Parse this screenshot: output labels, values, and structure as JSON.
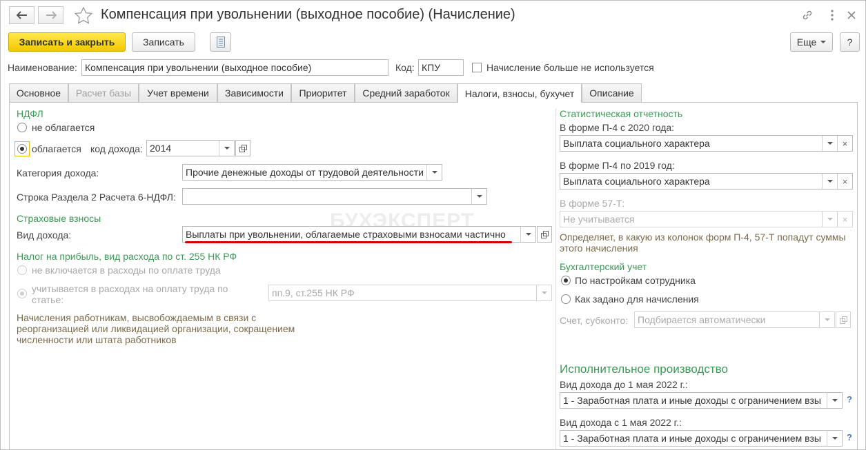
{
  "window": {
    "title": "Компенсация при увольнении (выходное пособие) (Начисление)"
  },
  "toolbar": {
    "save_close": "Записать и закрыть",
    "save": "Записать",
    "more": "Еще",
    "help": "?"
  },
  "header": {
    "name_label": "Наименование:",
    "name_value": "Компенсация при увольнении (выходное пособие)",
    "code_label": "Код:",
    "code_value": "КПУ",
    "unused_label": "Начисление больше не используется"
  },
  "tabs": [
    {
      "label": "Основное"
    },
    {
      "label": "Расчет базы"
    },
    {
      "label": "Учет времени"
    },
    {
      "label": "Зависимости"
    },
    {
      "label": "Приоритет"
    },
    {
      "label": "Средний заработок"
    },
    {
      "label": "Налоги, взносы, бухучет"
    },
    {
      "label": "Описание"
    }
  ],
  "left": {
    "ndfl_title": "НДФЛ",
    "not_taxed": "не облагается",
    "taxed": "облагается",
    "income_code_label": "код дохода:",
    "income_code_value": "2014",
    "income_category_label": "Категория дохода:",
    "income_category_value": "Прочие денежные доходы от трудовой деятельности",
    "line6_label": "Строка Раздела 2 Расчета 6-НДФЛ:",
    "line6_value": "",
    "insurance_title": "Страховые взносы",
    "income_type_label": "Вид дохода:",
    "income_type_value": "Выплаты при увольнении, облагаемые страховыми взносами частично",
    "profit_tax_title": "Налог на прибыль, вид расхода по ст. 255 НК РФ",
    "not_included": "не включается в расходы по оплате труда",
    "included_line1": "учитывается в расходах на оплату труда по",
    "included_line2": "статье:",
    "article_value": "пп.9, ст.255 НК РФ",
    "note_line1": "Начисления работникам, высвобождаемым в связи с",
    "note_line2": "реорганизацией или ликвидацией организации, сокращением",
    "note_line3": "численности или штата работников"
  },
  "right": {
    "stat_title": "Статистическая отчетность",
    "p4_2020_label": "В форме П-4 с 2020 года:",
    "p4_2020_value": "Выплата социального характера",
    "p4_2019_label": "В форме П-4 по 2019 год:",
    "p4_2019_value": "Выплата социального характера",
    "f57_label": "В форме 57-Т:",
    "f57_value": "Не учитывается",
    "stat_note_line1": "Определяет, в какую из колонок форм П-4, 57-Т попадут суммы",
    "stat_note_line2": "этого начисления",
    "acc_title": "Бухгалтерский учет",
    "acc_by_employee": "По настройкам сотрудника",
    "acc_as_set": "Как задано для начисления",
    "account_label": "Счет, субконто:",
    "account_placeholder": "Подбирается автоматически",
    "exec_title": "Исполнительное производство",
    "exec_before_label": "Вид дохода до 1 мая 2022 г.:",
    "exec_before_value": "1 - Заработная плата и иные доходы с ограничением взы",
    "exec_after_label": "Вид дохода с 1 мая 2022 г.:",
    "exec_after_value": "1 - Заработная плата и иные доходы с ограничением взы",
    "help_mark": "?"
  },
  "watermark": "БУХЭКСПЕРТ",
  "colors": {
    "accent_yellow": "#f3c800",
    "section_green": "#3a9a54",
    "highlight_red": "#d40000"
  }
}
